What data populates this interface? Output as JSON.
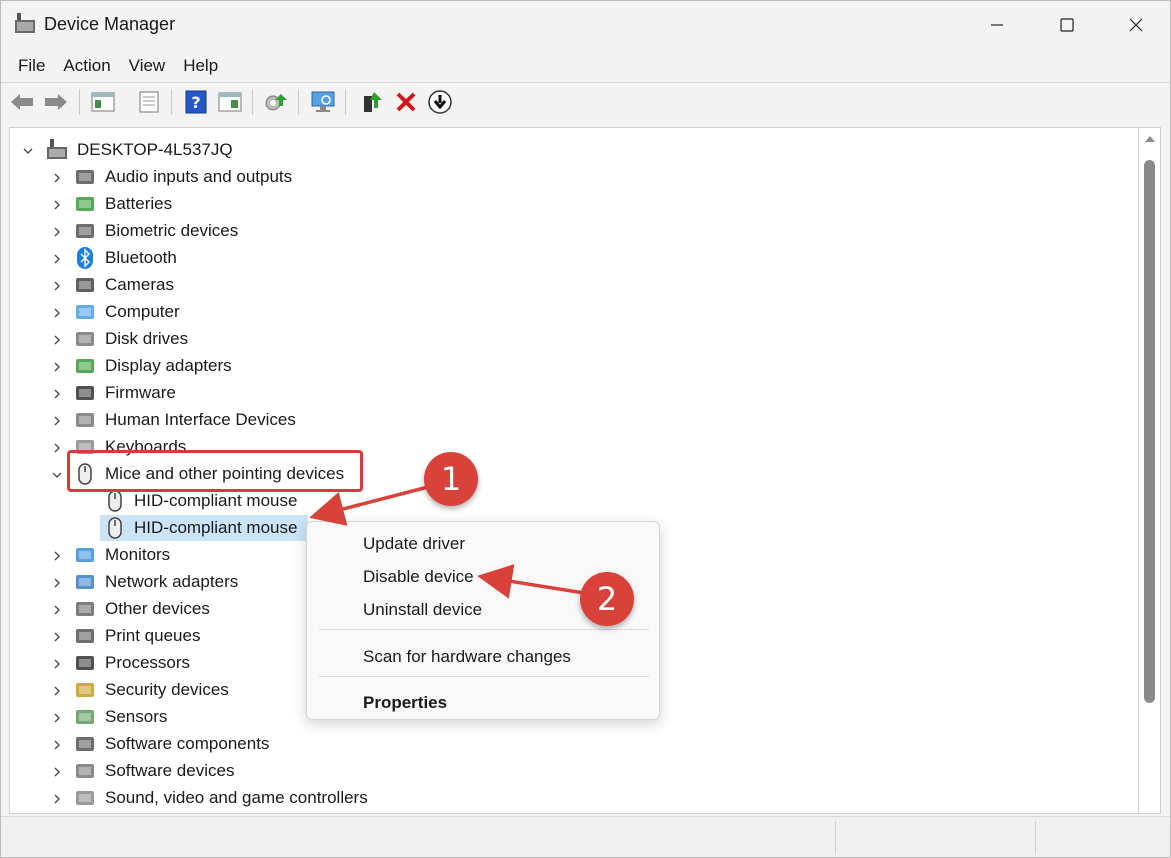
{
  "window": {
    "title": "Device Manager"
  },
  "menu": [
    "File",
    "Action",
    "View",
    "Help"
  ],
  "toolbar_icons": [
    "back-arrow-icon",
    "forward-arrow-icon",
    "show-hide-console-tree-icon",
    "properties-icon",
    "help-icon",
    "action-pane-icon",
    "update-driver-icon",
    "scan-hardware-icon",
    "enable-device-icon",
    "uninstall-device-icon",
    "disable-device-icon"
  ],
  "tree": {
    "root": "DESKTOP-4L537JQ",
    "categories": [
      "Audio inputs and outputs",
      "Batteries",
      "Biometric devices",
      "Bluetooth",
      "Cameras",
      "Computer",
      "Disk drives",
      "Display adapters",
      "Firmware",
      "Human Interface Devices",
      "Keyboards",
      "Mice and other pointing devices",
      "Monitors",
      "Network adapters",
      "Other devices",
      "Print queues",
      "Processors",
      "Security devices",
      "Sensors",
      "Software components",
      "Software devices",
      "Sound, video and game controllers"
    ],
    "mice_children": [
      "HID-compliant mouse",
      "HID-compliant mouse"
    ]
  },
  "context_menu": {
    "update": "Update driver",
    "disable": "Disable device",
    "uninstall": "Uninstall device",
    "scan": "Scan for hardware changes",
    "properties": "Properties"
  },
  "annotations": {
    "step1": "1",
    "step2": "2",
    "color": "#d9413b"
  },
  "colors": {
    "selection": "#cce4f7",
    "accent_red": "#d63b3b"
  }
}
